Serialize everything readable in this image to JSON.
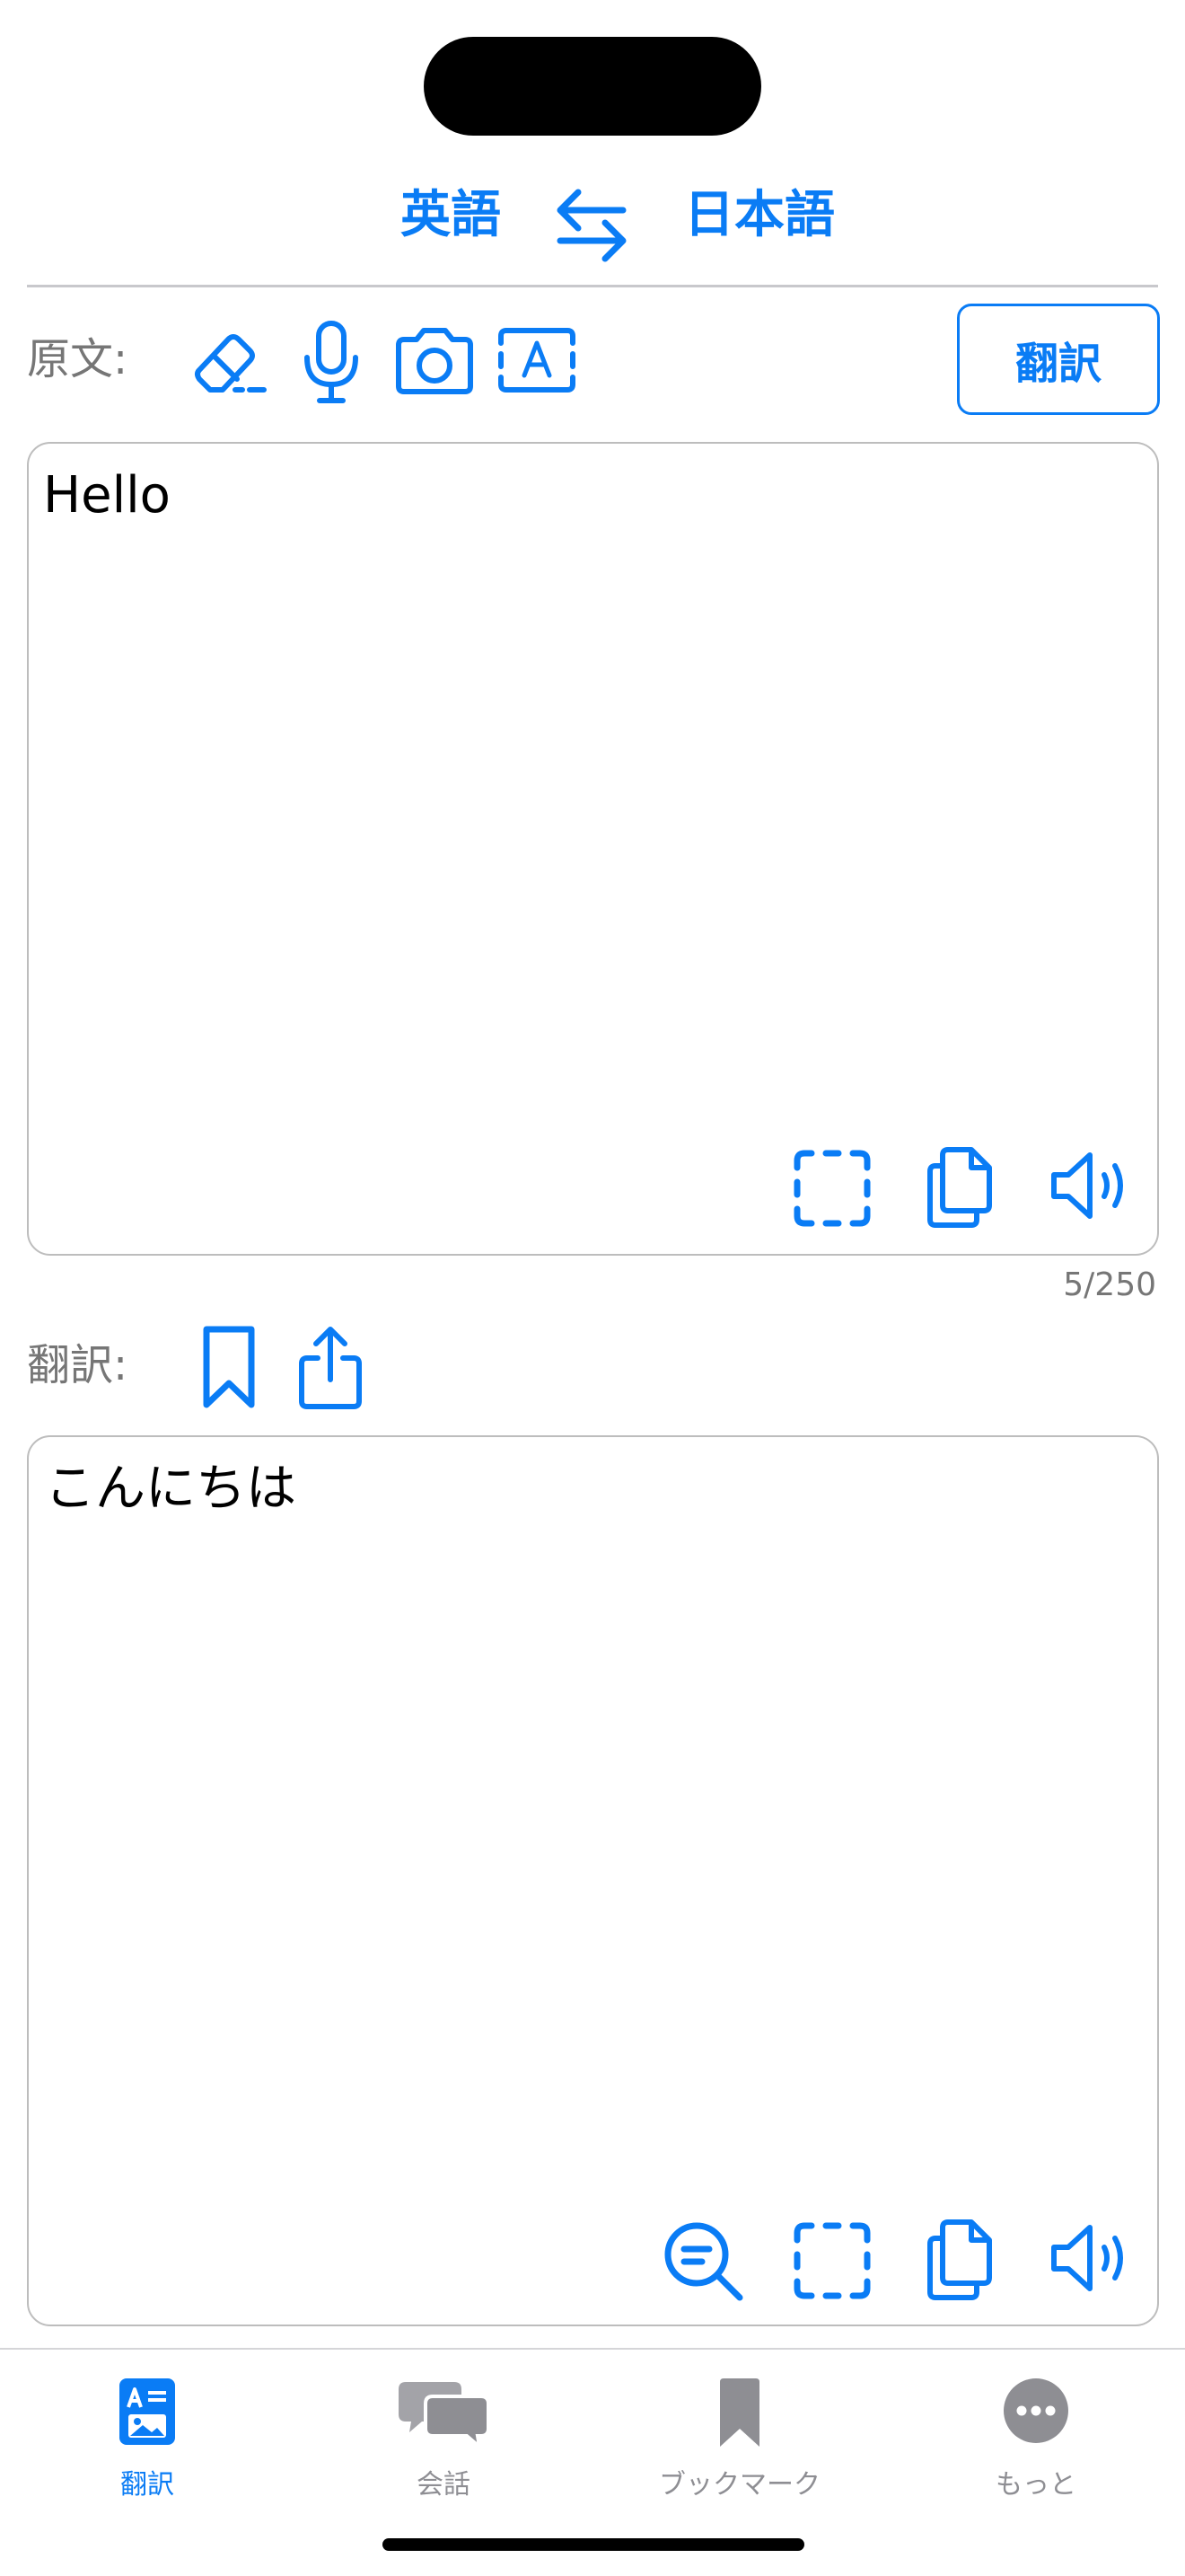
{
  "languages": {
    "source": "英語",
    "target": "日本語"
  },
  "source_section": {
    "label": "原文:",
    "translate_button": "翻訳",
    "text": "Hello",
    "counter": "5/250"
  },
  "result_section": {
    "label": "翻訳:",
    "text": "こんにちは"
  },
  "tabs": [
    {
      "label": "翻訳",
      "icon": "translate-icon",
      "active": true
    },
    {
      "label": "会話",
      "icon": "chat-bubbles-icon",
      "active": false
    },
    {
      "label": "ブックマーク",
      "icon": "bookmark-icon",
      "active": false
    },
    {
      "label": "もっと",
      "icon": "more-icon",
      "active": false
    }
  ],
  "colors": {
    "accent": "#0a7cf5",
    "muted": "#767676",
    "inactive": "#8e8e93",
    "border": "#bdbdbd"
  }
}
